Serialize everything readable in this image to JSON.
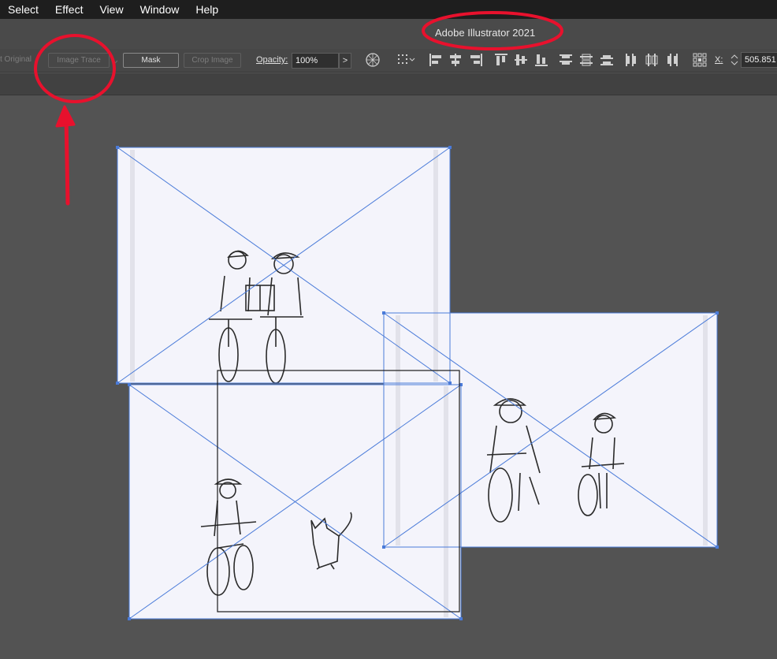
{
  "menu": [
    "Select",
    "Effect",
    "View",
    "Window",
    "Help"
  ],
  "app_title": "Adobe Illustrator 2021",
  "controlbar": {
    "embed_original": "t Original",
    "image_trace": "Image Trace",
    "mask": "Mask",
    "crop_image": "Crop Image",
    "opacity_label": "Opacity:",
    "opacity_value": "100%",
    "opacity_arrow": ">",
    "x_label": "X:",
    "x_value": "505.851"
  },
  "colors": {
    "annotation": "#e8112d",
    "selection": "#4a7bd9",
    "artboard_bg": "#535353"
  },
  "icons": [
    "recolor-icon",
    "align-to-icon",
    "align-left-icon",
    "align-hcenter-icon",
    "align-right-icon",
    "align-top-icon",
    "align-vcenter-icon",
    "align-bottom-icon",
    "distribute-top-icon",
    "distribute-vcenter-icon",
    "distribute-bottom-icon",
    "distribute-left-icon",
    "distribute-hcenter-icon",
    "distribute-right-icon",
    "reference-point-icon"
  ]
}
